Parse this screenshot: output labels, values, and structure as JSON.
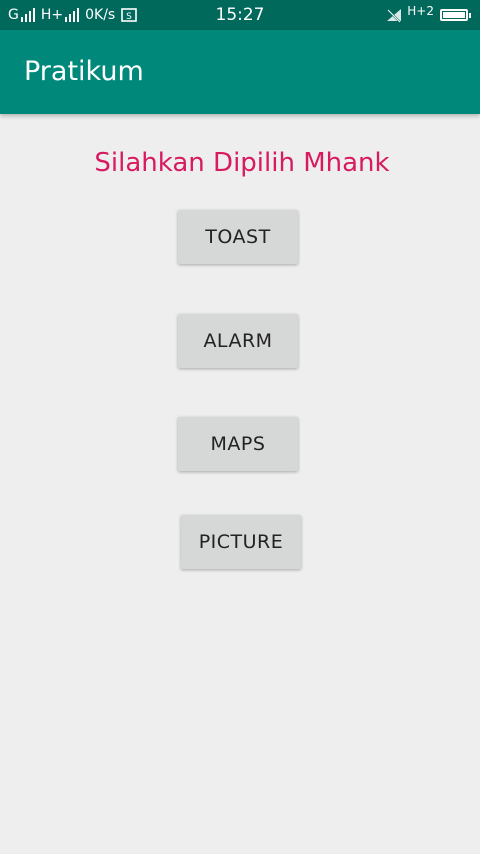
{
  "status_bar": {
    "carrier_left": "G",
    "carrier_mid": "H+",
    "speed": "0K/s",
    "time": "15:27",
    "network_right": "H+2",
    "battery_level": 1.0
  },
  "app_bar": {
    "title": "Pratikum"
  },
  "main": {
    "headline": "Silahkan Dipilih Mhank",
    "buttons": {
      "toast": "TOAST",
      "alarm": "ALARM",
      "maps": "MAPS",
      "picture": "PICTURE"
    }
  },
  "colors": {
    "status_bar": "#00695c",
    "app_bar": "#00897b",
    "headline": "#d81b60",
    "button_bg": "#d6d7d7",
    "background": "#eeeeee"
  },
  "icons": {
    "signal": "signal-bars-icon",
    "screenshot": "screenshot-icon",
    "mute": "wifi-off-icon",
    "battery": "battery-icon"
  }
}
